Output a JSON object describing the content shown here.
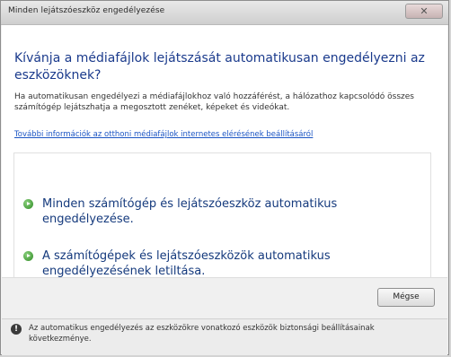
{
  "window": {
    "title": "Minden lejátszóeszköz engedélyezése",
    "close_label": "✕"
  },
  "main": {
    "question": "Kívánja a médiafájlok lejátszását automatikusan engedélyezni az eszközöknek?",
    "description": "Ha automatikusan engedélyezi a médiafájlokhoz való hozzáférést, a hálózathoz kapcsolódó összes számítógép lejátszhatja a megosztott zenéket, képeket és videókat.",
    "link": "További információk az otthoni médiafájlok internetes elérésének beállításáról",
    "options": [
      {
        "label": "Minden számítógép és lejátszóeszköz automatikus engedélyezése."
      },
      {
        "label": "A számítógépek és lejátszóeszközök automatikus engedélyezésének letiltása."
      }
    ]
  },
  "footer": {
    "cancel_label": "Mégse",
    "info_text": "Az automatikus engedélyezés az eszközökre vonatkozó eszközök biztonsági beállításainak következménye."
  }
}
